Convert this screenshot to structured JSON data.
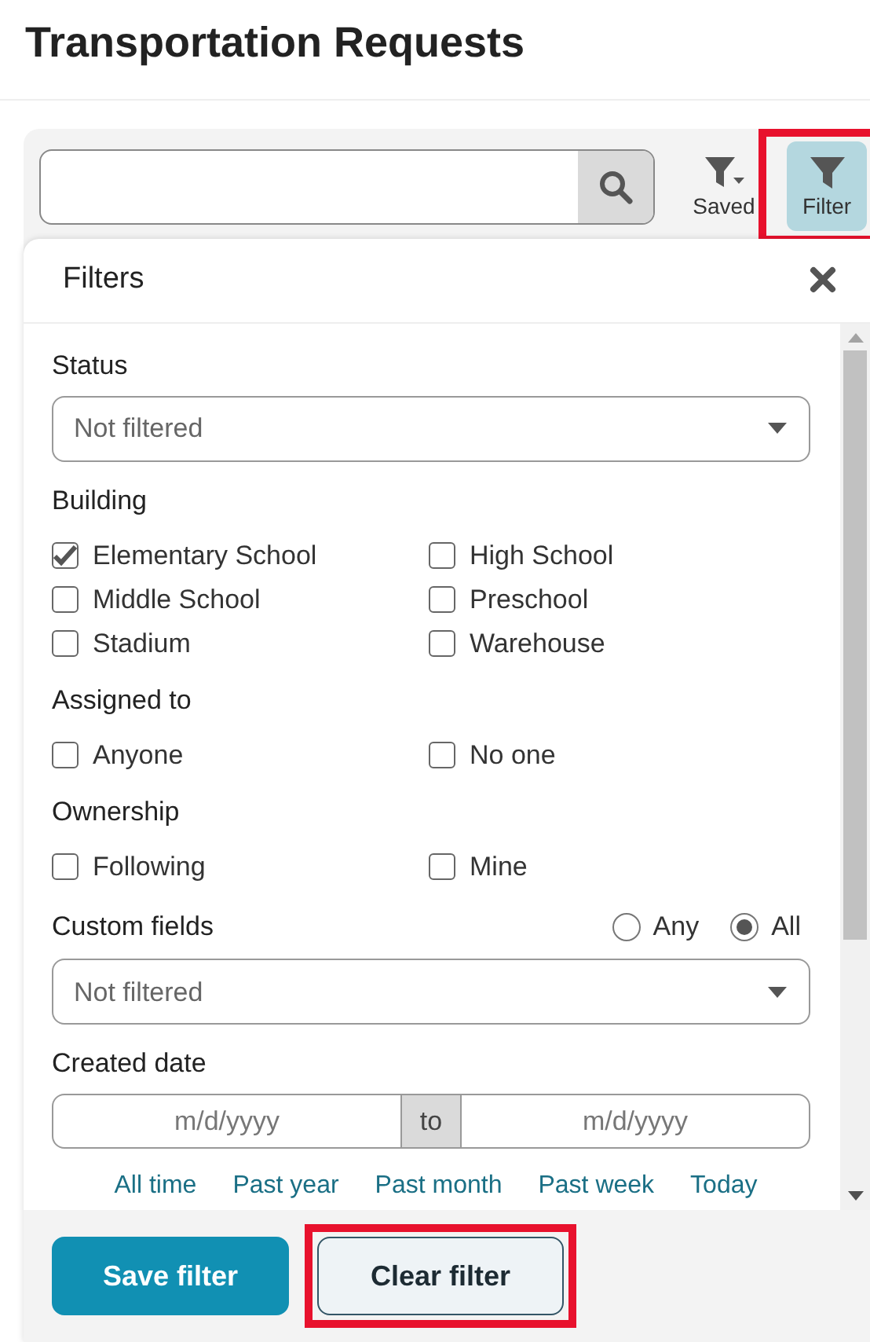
{
  "page": {
    "title": "Transportation Requests"
  },
  "toolbar": {
    "buttons": [
      {
        "label": "Saved",
        "kind": "saved",
        "selected": false,
        "highlighted": false
      },
      {
        "label": "Filter",
        "kind": "filter",
        "selected": true,
        "highlighted": true
      }
    ]
  },
  "filters_panel": {
    "title": "Filters",
    "sections": [
      {
        "kind": "select",
        "label": "Status",
        "value": "Not filtered"
      },
      {
        "kind": "checkboxes",
        "label": "Building",
        "options": [
          {
            "label": "Elementary School",
            "checked": true
          },
          {
            "label": "High School",
            "checked": false
          },
          {
            "label": "Middle School",
            "checked": false
          },
          {
            "label": "Preschool",
            "checked": false
          },
          {
            "label": "Stadium",
            "checked": false
          },
          {
            "label": "Warehouse",
            "checked": false
          }
        ]
      },
      {
        "kind": "checkboxes",
        "label": "Assigned to",
        "options": [
          {
            "label": "Anyone",
            "checked": false
          },
          {
            "label": "No one",
            "checked": false
          }
        ]
      },
      {
        "kind": "checkboxes",
        "label": "Ownership",
        "options": [
          {
            "label": "Following",
            "checked": false
          },
          {
            "label": "Mine",
            "checked": false
          }
        ]
      },
      {
        "kind": "select",
        "label": "Custom fields",
        "value": "Not filtered",
        "match": [
          {
            "label": "Any",
            "selected": false
          },
          {
            "label": "All",
            "selected": true
          }
        ]
      },
      {
        "kind": "date_range",
        "label": "Created date",
        "from": {
          "placeholder": "m/d/yyyy"
        },
        "separator": "to",
        "to": {
          "placeholder": "m/d/yyyy"
        },
        "presets": [
          "All time",
          "Past year",
          "Past month",
          "Past week",
          "Today"
        ]
      }
    ],
    "footer": {
      "buttons": [
        {
          "label": "Save filter",
          "kind": "primary",
          "highlighted": false
        },
        {
          "label": "Clear filter",
          "kind": "secondary",
          "highlighted": true
        }
      ]
    }
  }
}
